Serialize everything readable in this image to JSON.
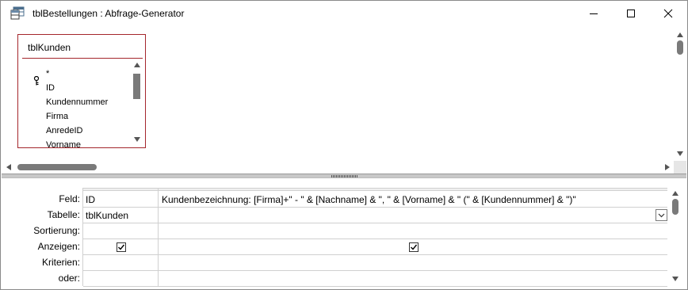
{
  "window": {
    "title": "tblBestellungen : Abfrage-Generator",
    "icon": "query-designer-icon"
  },
  "table_box": {
    "name": "tblKunden",
    "fields": [
      "*",
      "ID",
      "Kundennummer",
      "Firma",
      "AnredeID",
      "Vorname"
    ],
    "primary_key_field": "ID",
    "border_color": "#a4262c"
  },
  "grid": {
    "row_labels": [
      "Feld:",
      "Tabelle:",
      "Sortierung:",
      "Anzeigen:",
      "Kriterien:",
      "oder:"
    ],
    "columns": [
      {
        "feld": "ID",
        "tabelle": "tblKunden",
        "sortierung": "",
        "anzeigen": true,
        "kriterien": "",
        "oder": ""
      },
      {
        "feld": "Kundenbezeichnung: [Firma]+\" - \" & [Nachname] & \", \" & [Vorname] & \" (\" & [Kundennummer] & \")\"",
        "tabelle": "",
        "sortierung": "",
        "anzeigen": true,
        "kriterien": "",
        "oder": ""
      }
    ]
  }
}
